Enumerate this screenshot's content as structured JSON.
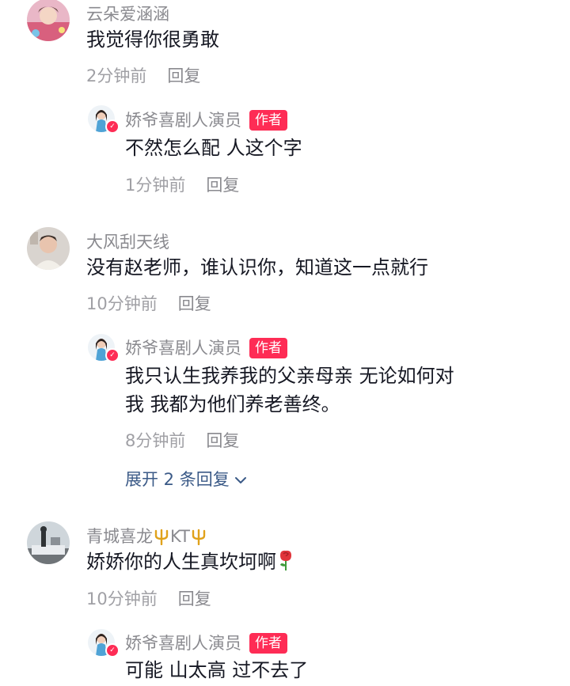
{
  "comments": [
    {
      "username": "云朵爱涵涵",
      "text": "我觉得你很勇敢",
      "time": "2分钟前",
      "reply_label": "回复",
      "reply": {
        "username": "娇爷喜剧人演员",
        "badge": "作者",
        "text": "不然怎么配 人这个字",
        "time": "1分钟前",
        "reply_label": "回复"
      }
    },
    {
      "username": "大风刮天线",
      "text": "没有赵老师，谁认识你，知道这一点就行",
      "time": "10分钟前",
      "reply_label": "回复",
      "reply": {
        "username": "娇爷喜剧人演员",
        "badge": "作者",
        "text_line1": "我只认生我养我的父亲母亲 无论如何对",
        "text_line2": "我 我都为他们养老善终。",
        "time": "8分钟前",
        "reply_label": "回复"
      },
      "expand_label": "展开 2 条回复"
    },
    {
      "username_prefix": "青城喜龙",
      "username_suffix": "KT",
      "username_icons": [
        "trident-icon",
        "trident-icon"
      ],
      "text": "娇娇你的人生真坎坷啊",
      "text_icon": "rose-icon",
      "time": "10分钟前",
      "reply_label": "回复",
      "reply": {
        "username": "娇爷喜剧人演员",
        "badge": "作者",
        "text": "可能 山太高 过不去了"
      }
    }
  ],
  "colors": {
    "author_badge": "#fe2c55",
    "expand_link": "#3b5a87",
    "meta": "#a0a0a5",
    "username": "#8a8a8f"
  }
}
